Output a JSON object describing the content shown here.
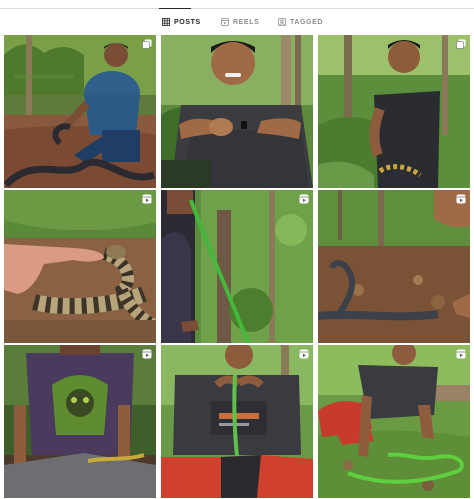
{
  "tabs": [
    {
      "label": "POSTS",
      "icon": "grid-icon",
      "active": true
    },
    {
      "label": "REELS",
      "icon": "reels-icon",
      "active": false
    },
    {
      "label": "TAGGED",
      "icon": "tagged-icon",
      "active": false
    }
  ],
  "colors": {
    "active_text": "#262626",
    "inactive_text": "#8e8e8e",
    "divider": "#dbdbdb"
  },
  "posts": [
    {
      "badge": "multiple-photos-icon"
    },
    {
      "badge": null
    },
    {
      "badge": "multiple-photos-icon"
    },
    {
      "badge": "reel-icon"
    },
    {
      "badge": "reel-icon"
    },
    {
      "badge": "reel-icon"
    },
    {
      "badge": "reel-icon"
    },
    {
      "badge": "reel-icon"
    },
    {
      "badge": "reel-icon"
    }
  ]
}
